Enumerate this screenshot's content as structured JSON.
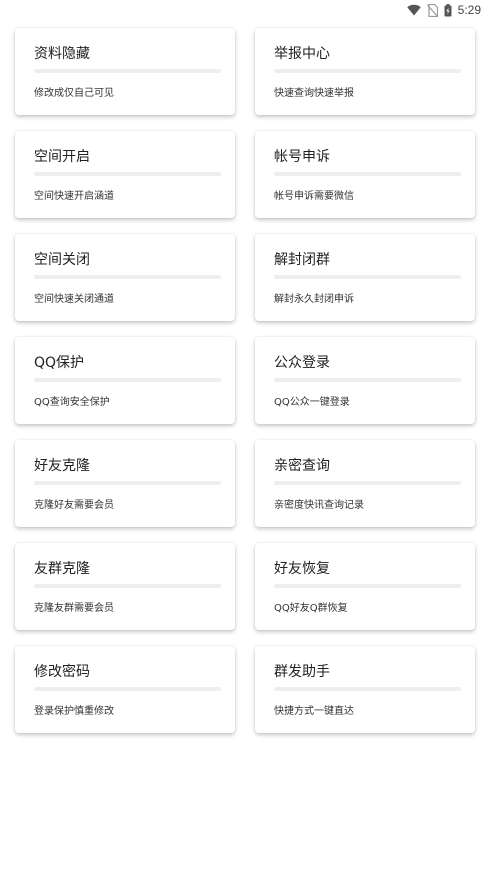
{
  "status_bar": {
    "time": "5:29",
    "icons": [
      "wifi-icon",
      "no-sim-icon",
      "battery-icon"
    ]
  },
  "cards": [
    {
      "title": "资料隐藏",
      "desc": "修改成仅自己可见"
    },
    {
      "title": "举报中心",
      "desc": "快速查询快速举报"
    },
    {
      "title": "空间开启",
      "desc": "空间快速开启涵道"
    },
    {
      "title": "帐号申诉",
      "desc": "帐号申诉需要微信"
    },
    {
      "title": "空间关闭",
      "desc": "空间快速关闭通道"
    },
    {
      "title": "解封闭群",
      "desc": "解封永久封闭申诉"
    },
    {
      "title": "QQ保护",
      "desc": "QQ查询安全保护"
    },
    {
      "title": "公众登录",
      "desc": "QQ公众一键登录"
    },
    {
      "title": "好友克隆",
      "desc": "克隆好友需要会员"
    },
    {
      "title": "亲密查询",
      "desc": "亲密度快讯查询记录"
    },
    {
      "title": "友群克隆",
      "desc": "克隆友群需要会员"
    },
    {
      "title": "好友恢复",
      "desc": "QQ好友Q群恢复"
    },
    {
      "title": "修改密码",
      "desc": "登录保护慎重修改"
    },
    {
      "title": "群发助手",
      "desc": "快捷方式一键直达"
    }
  ]
}
